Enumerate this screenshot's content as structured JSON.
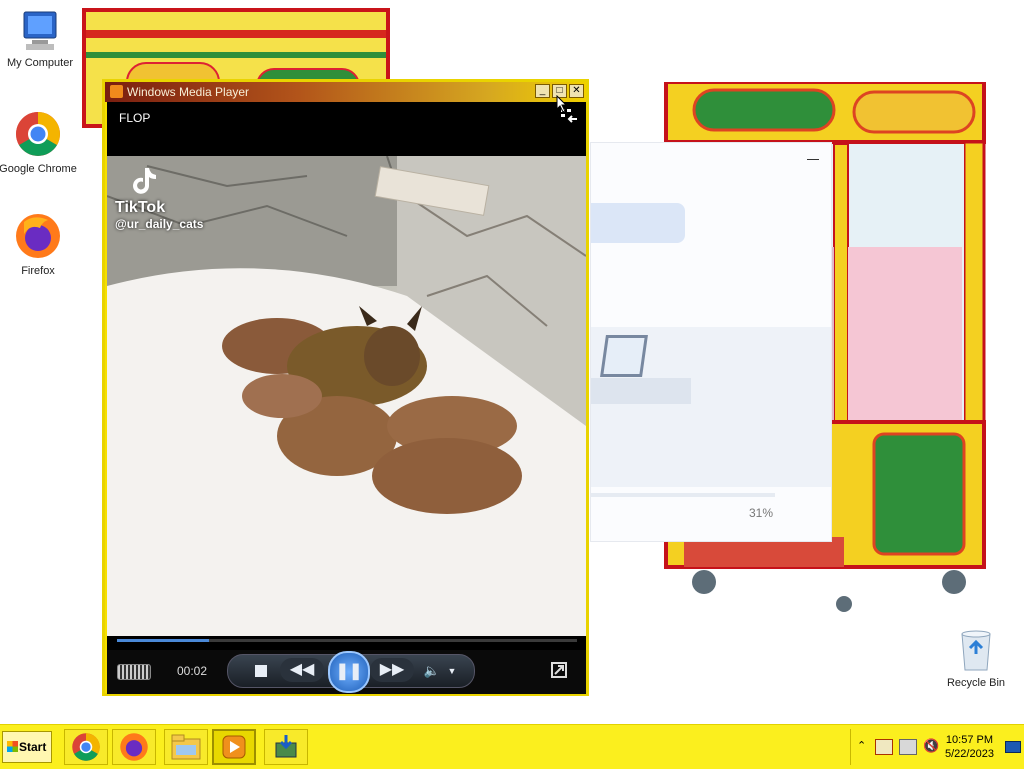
{
  "desktop": {
    "icons": [
      {
        "label": "My Computer",
        "icon": "computer-icon"
      },
      {
        "label": "Google Chrome",
        "icon": "chrome-icon"
      },
      {
        "label": "Firefox",
        "icon": "firefox-icon"
      },
      {
        "label": "Recycle Bin",
        "icon": "recycle-bin-icon"
      }
    ]
  },
  "wmp": {
    "title": "Windows Media Player",
    "now_playing": "FLOP",
    "video_overlay": {
      "brand": "TikTok",
      "handle": "@ur_daily_cats"
    },
    "time": "00:02",
    "progress": 0.2,
    "buttons": {
      "minimize": "_",
      "maximize": "□",
      "close": "✕"
    }
  },
  "background_window": {
    "progress_text": "31%"
  },
  "taskbar": {
    "start_label": "Start",
    "apps": [
      {
        "name": "chrome-icon"
      },
      {
        "name": "firefox-icon"
      },
      {
        "name": "file-explorer-icon"
      },
      {
        "name": "windows-media-player-icon"
      },
      {
        "name": "installer-icon"
      }
    ],
    "clock": {
      "time": "10:57 PM",
      "date": "5/22/2023"
    }
  },
  "colors": {
    "taskbar": "#fbef1e",
    "title_gradient_start": "#7a1e10",
    "title_gradient_end": "#f1d000",
    "seek_fill": "#4a88d6"
  }
}
